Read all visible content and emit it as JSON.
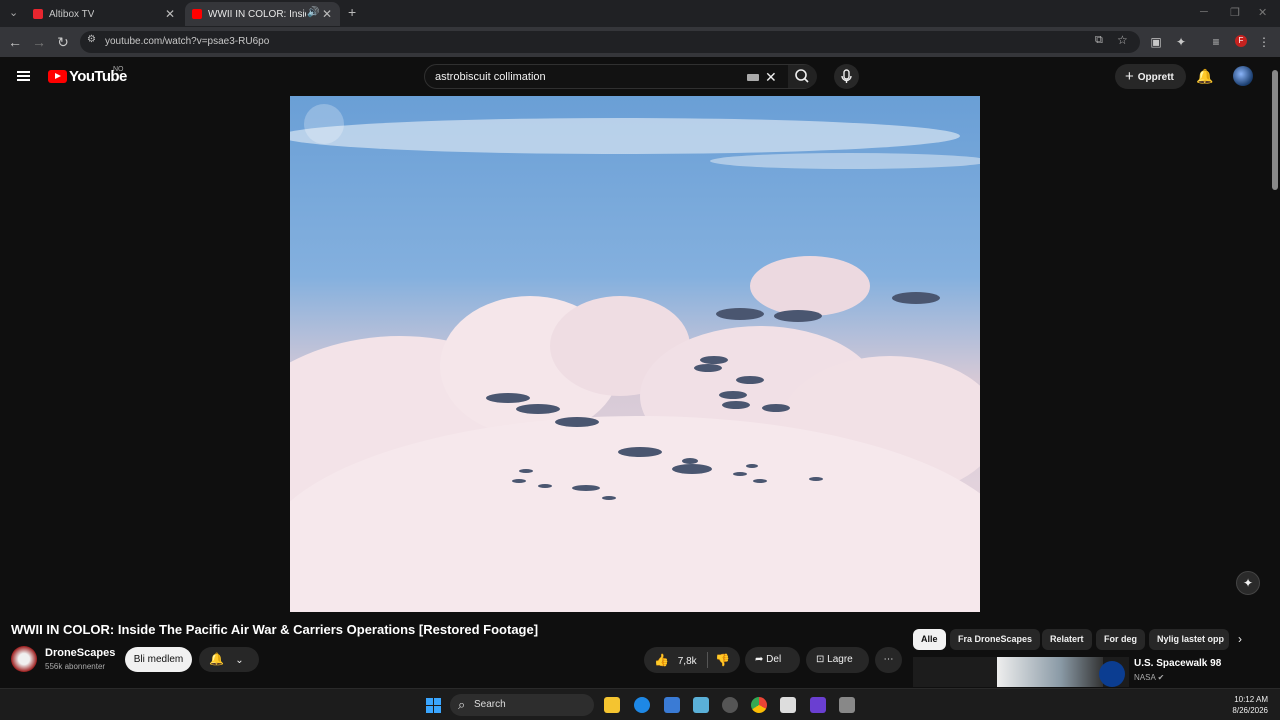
{
  "browser": {
    "tabs": [
      {
        "title": "Altibox TV",
        "color": "#e8262f"
      },
      {
        "title": "WWII IN COLOR: Inside The",
        "color": "#ff0000"
      }
    ],
    "new_tab": "+",
    "url": "youtube.com/watch?v=psae3-RU6po",
    "profile_letter": "F"
  },
  "youtube": {
    "logo_text": "YouTube",
    "country_code": "NO",
    "search_query": "astrobiscuit collimation",
    "create_label": "Opprett"
  },
  "video": {
    "title": "WWII IN COLOR: Inside The Pacific Air War & Carriers Operations [Restored Footage]",
    "channel": "DroneScapes",
    "subscribers": "556k abonnenter",
    "join_label": "Bli medlem",
    "likes": "7,8k",
    "share_label": "Del",
    "save_label": "Lagre"
  },
  "chips": [
    "Alle",
    "Fra DroneScapes",
    "Relatert",
    "For deg",
    "Nylig lastet opp"
  ],
  "related": [
    {
      "title": "U.S. Spacewalk 98",
      "channel": "NASA"
    }
  ],
  "taskbar": {
    "search_label": "Search",
    "time": "10:12 AM",
    "date": "8/26/2026"
  },
  "colors": {
    "brand": "#ff0000",
    "background": "#0f0f0f"
  }
}
